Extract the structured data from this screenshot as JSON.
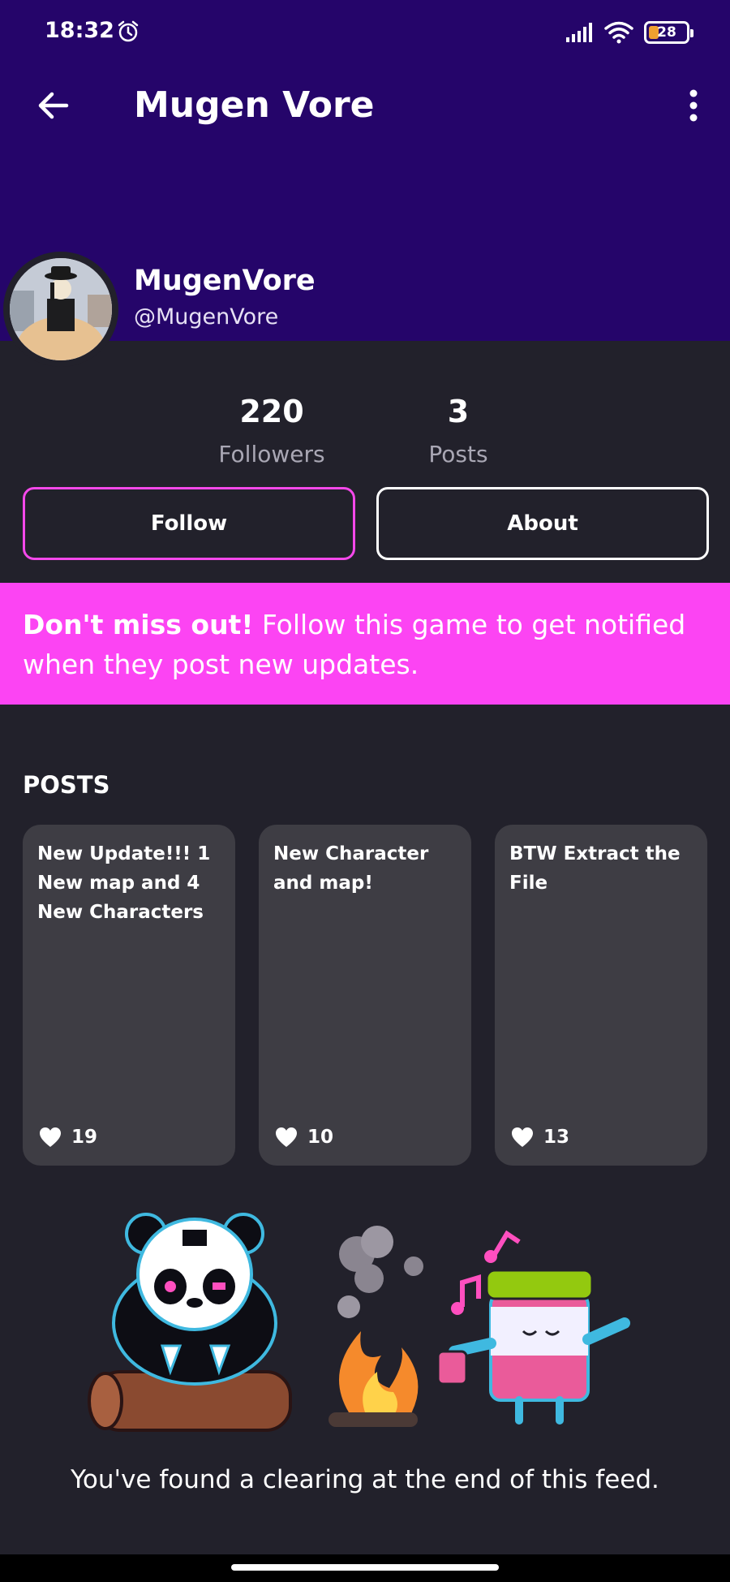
{
  "status_bar": {
    "time": "18:32",
    "battery": "28",
    "icons": [
      "alarm-icon",
      "signal-icon",
      "wifi-icon",
      "battery-icon"
    ]
  },
  "header": {
    "title": "Mugen Vore",
    "back_icon": "arrow-left-icon",
    "menu_icon": "more-vertical-icon",
    "background": "#25056a"
  },
  "profile": {
    "name": "MugenVore",
    "handle": "@MugenVore"
  },
  "stats": {
    "followers_value": "220",
    "followers_label": "Followers",
    "posts_value": "3",
    "posts_label": "Posts"
  },
  "actions": {
    "follow_label": "Follow",
    "about_label": "About",
    "accent": "#f448ea"
  },
  "banner": {
    "strong": "Don't miss out!",
    "text": " Follow this game to get notified when they post new updates.",
    "background": "#fc44f3"
  },
  "posts": {
    "heading": "POSTS",
    "items": [
      {
        "title": "New Update!!! 1 New map and 4 New Characters",
        "likes": "19"
      },
      {
        "title": "New Character and map!",
        "likes": "10"
      },
      {
        "title": "BTW Extract the File",
        "likes": "13"
      }
    ]
  },
  "feed_end": {
    "message": "You've found a clearing at the end of this feed."
  }
}
